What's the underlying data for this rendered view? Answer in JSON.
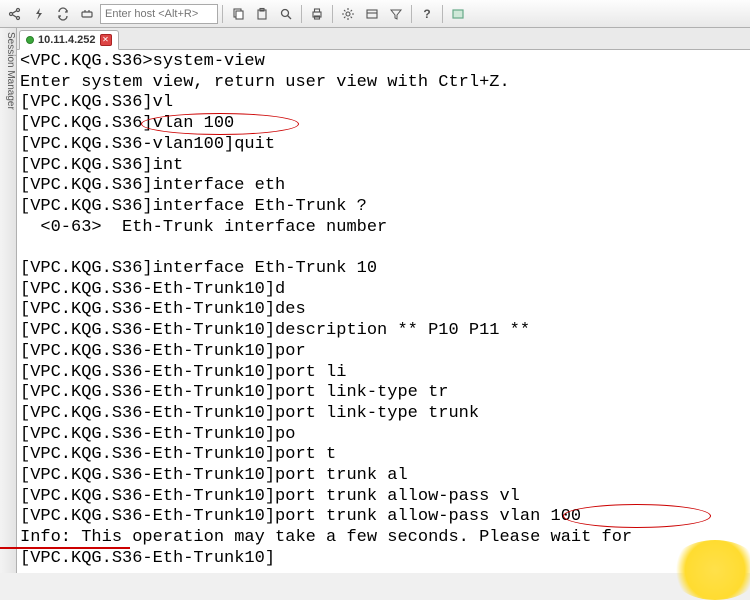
{
  "toolbar": {
    "host_placeholder": "Enter host <Alt+R>"
  },
  "session_manager_label": "Session Manager",
  "tab": {
    "label": "10.11.4.252"
  },
  "terminal_lines": [
    "<VPC.KQG.S36>system-view",
    "Enter system view, return user view with Ctrl+Z.",
    "[VPC.KQG.S36]vl",
    "[VPC.KQG.S36]vlan 100",
    "[VPC.KQG.S36-vlan100]quit",
    "[VPC.KQG.S36]int",
    "[VPC.KQG.S36]interface eth",
    "[VPC.KQG.S36]interface Eth-Trunk ?",
    "  <0-63>  Eth-Trunk interface number",
    "",
    "[VPC.KQG.S36]interface Eth-Trunk 10",
    "[VPC.KQG.S36-Eth-Trunk10]d",
    "[VPC.KQG.S36-Eth-Trunk10]des",
    "[VPC.KQG.S36-Eth-Trunk10]description ** P10 P11 **",
    "[VPC.KQG.S36-Eth-Trunk10]por",
    "[VPC.KQG.S36-Eth-Trunk10]port li",
    "[VPC.KQG.S36-Eth-Trunk10]port link-type tr",
    "[VPC.KQG.S36-Eth-Trunk10]port link-type trunk",
    "[VPC.KQG.S36-Eth-Trunk10]po",
    "[VPC.KQG.S36-Eth-Trunk10]port t",
    "[VPC.KQG.S36-Eth-Trunk10]port trunk al",
    "[VPC.KQG.S36-Eth-Trunk10]port trunk allow-pass vl",
    "[VPC.KQG.S36-Eth-Trunk10]port trunk allow-pass vlan 100",
    "Info: This operation may take a few seconds. Please wait for",
    "[VPC.KQG.S36-Eth-Trunk10]"
  ]
}
